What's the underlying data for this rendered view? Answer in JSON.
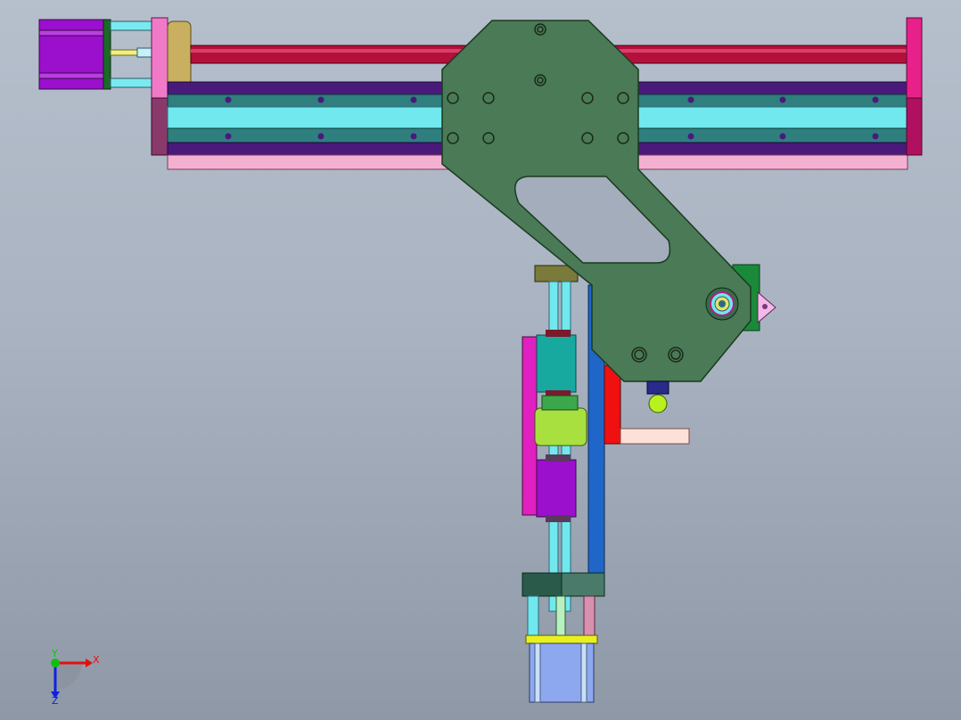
{
  "viewport": {
    "background_top": "#b6bfcc",
    "background_bottom": "#8e98a6"
  },
  "triad": {
    "x_label": "X",
    "y_label": "Y",
    "z_label": "Z",
    "x_color": "#e01010",
    "y_color": "#10c010",
    "z_color": "#1020e0"
  },
  "colors": {
    "motor_purple": "#9a10cc",
    "rod_red": "#b3103c",
    "rail_purple": "#4a1a7a",
    "rail_teal": "#2f7f7f",
    "rail_cyan": "#70e8ee",
    "pink_bar": "#f4b0d0",
    "plate_green": "#4a7a56",
    "column_blue": "#2066c8",
    "end_magenta": "#e8208a"
  }
}
